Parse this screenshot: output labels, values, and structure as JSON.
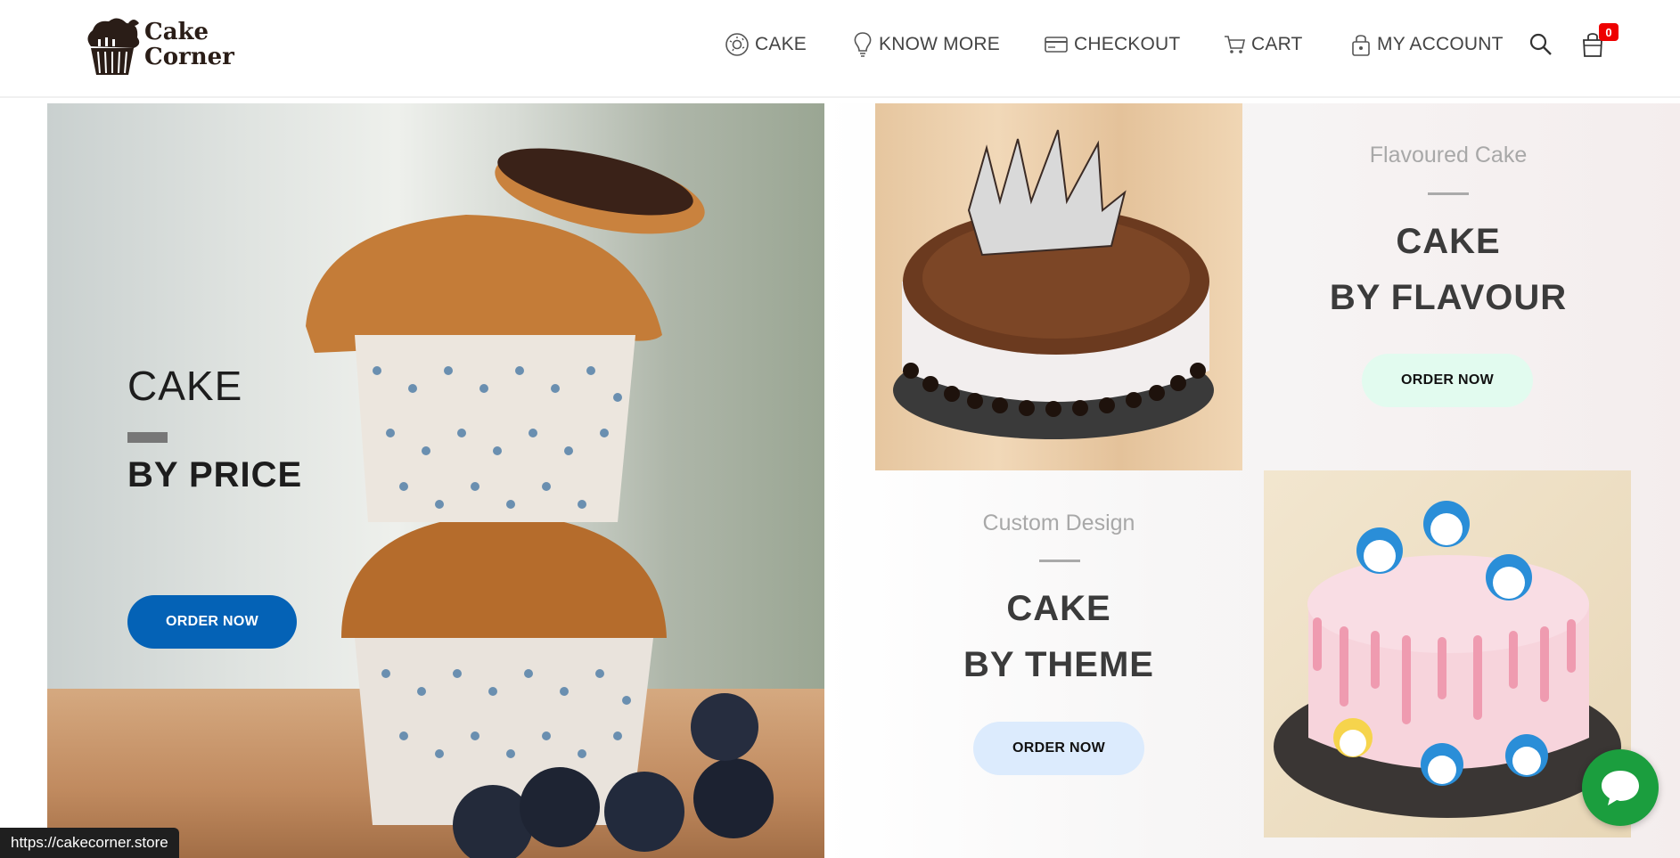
{
  "header": {
    "logo_text_line1": "Cake",
    "logo_text_line2": "Corner",
    "nav": [
      {
        "label": "CAKE",
        "icon": "donut-icon"
      },
      {
        "label": "KNOW MORE",
        "icon": "lightbulb-icon"
      },
      {
        "label": "CHECKOUT",
        "icon": "credit-card-icon"
      },
      {
        "label": "CART",
        "icon": "cart-icon"
      },
      {
        "label": "MY ACCOUNT",
        "icon": "lock-icon"
      }
    ],
    "cart_count": "0"
  },
  "hero_left": {
    "title_line1": "CAKE",
    "title_line2": "BY PRICE",
    "button": "ORDER NOW"
  },
  "flavour": {
    "subtitle": "Flavoured Cake",
    "title_line1": "CAKE",
    "title_line2": "BY FLAVOUR",
    "button": "ORDER NOW"
  },
  "theme": {
    "subtitle": "Custom Design",
    "title_line1": "CAKE",
    "title_line2": "BY THEME",
    "button": "ORDER NOW"
  },
  "status_bar": {
    "url": "https://cakecorner.store"
  },
  "colors": {
    "price_button": "#0462b6",
    "flavour_button": "#e2fbef",
    "theme_button": "#dcebfd",
    "chat": "#1b9e3e",
    "badge": "#e00000"
  }
}
